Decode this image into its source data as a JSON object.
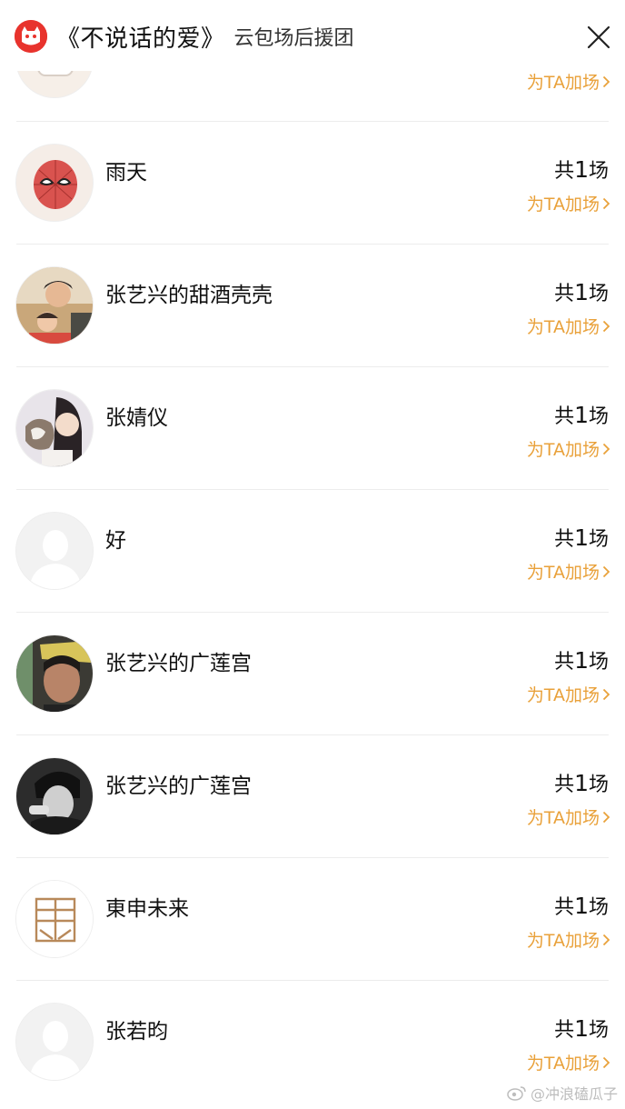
{
  "header": {
    "title": "《不说话的爱》",
    "subtitle": "云包场后援团",
    "logo_icon": "maoyan-cat-logo-icon",
    "close_icon": "close-icon"
  },
  "colors": {
    "accent": "#e9a13a",
    "logo_red": "#e8332d",
    "divider": "#ececec"
  },
  "partial_row": {
    "boost_label": "为TA加场"
  },
  "supporters": [
    {
      "name": "雨天",
      "count_prefix": "共",
      "count_num": "1",
      "count_suffix": "场",
      "boost_label": "为TA加场",
      "avatar": "spider-mask-avatar"
    },
    {
      "name": "张艺兴的甜酒壳壳",
      "count_prefix": "共",
      "count_num": "1",
      "count_suffix": "场",
      "boost_label": "为TA加场",
      "avatar": "photo-avatar"
    },
    {
      "name": "张婧仪",
      "count_prefix": "共",
      "count_num": "1",
      "count_suffix": "场",
      "boost_label": "为TA加场",
      "avatar": "photo-avatar"
    },
    {
      "name": "好",
      "count_prefix": "共",
      "count_num": "1",
      "count_suffix": "场",
      "boost_label": "为TA加场",
      "avatar": "default-user-avatar"
    },
    {
      "name": "张艺兴的广莲宫",
      "count_prefix": "共",
      "count_num": "1",
      "count_suffix": "场",
      "boost_label": "为TA加场",
      "avatar": "photo-avatar"
    },
    {
      "name": "张艺兴的广莲宫",
      "count_prefix": "共",
      "count_num": "1",
      "count_suffix": "场",
      "boost_label": "为TA加场",
      "avatar": "photo-avatar-bw"
    },
    {
      "name": "東申未来",
      "count_prefix": "共",
      "count_num": "1",
      "count_suffix": "场",
      "boost_label": "为TA加场",
      "avatar": "logo-avatar"
    },
    {
      "name": "张若昀",
      "count_prefix": "共",
      "count_num": "1",
      "count_suffix": "场",
      "boost_label": "为TA加场",
      "avatar": "default-user-avatar"
    }
  ],
  "watermark": {
    "text": "@冲浪磕瓜子",
    "icon": "weibo-icon"
  }
}
